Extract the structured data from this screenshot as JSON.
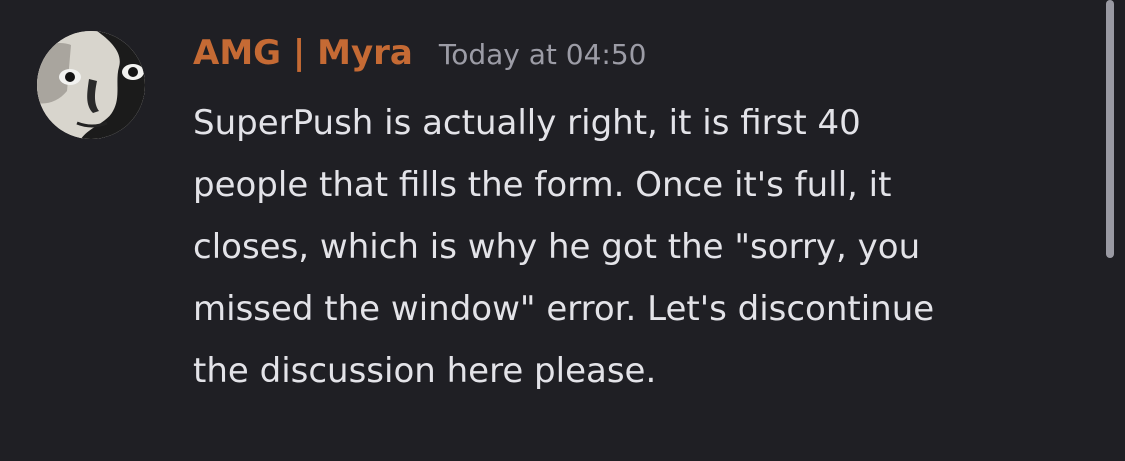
{
  "message": {
    "author": "AMG | Myra",
    "timestamp": "Today at 04:50",
    "lines": [
      "SuperPush is actually right, it is first 40",
      "people that fills the form. Once it's full, it",
      "closes, which is why he got the \"sorry, you",
      "missed the window\" error. Let's discontinue",
      "the discussion here please."
    ]
  },
  "colors": {
    "background": "#1f1f24",
    "author": "#c56a34",
    "timestamp": "#9c9ca6",
    "text": "#e3e3e8",
    "scrollbar": "#9a9aa3"
  },
  "icons": {
    "avatar": "avatar-portrait-image"
  }
}
